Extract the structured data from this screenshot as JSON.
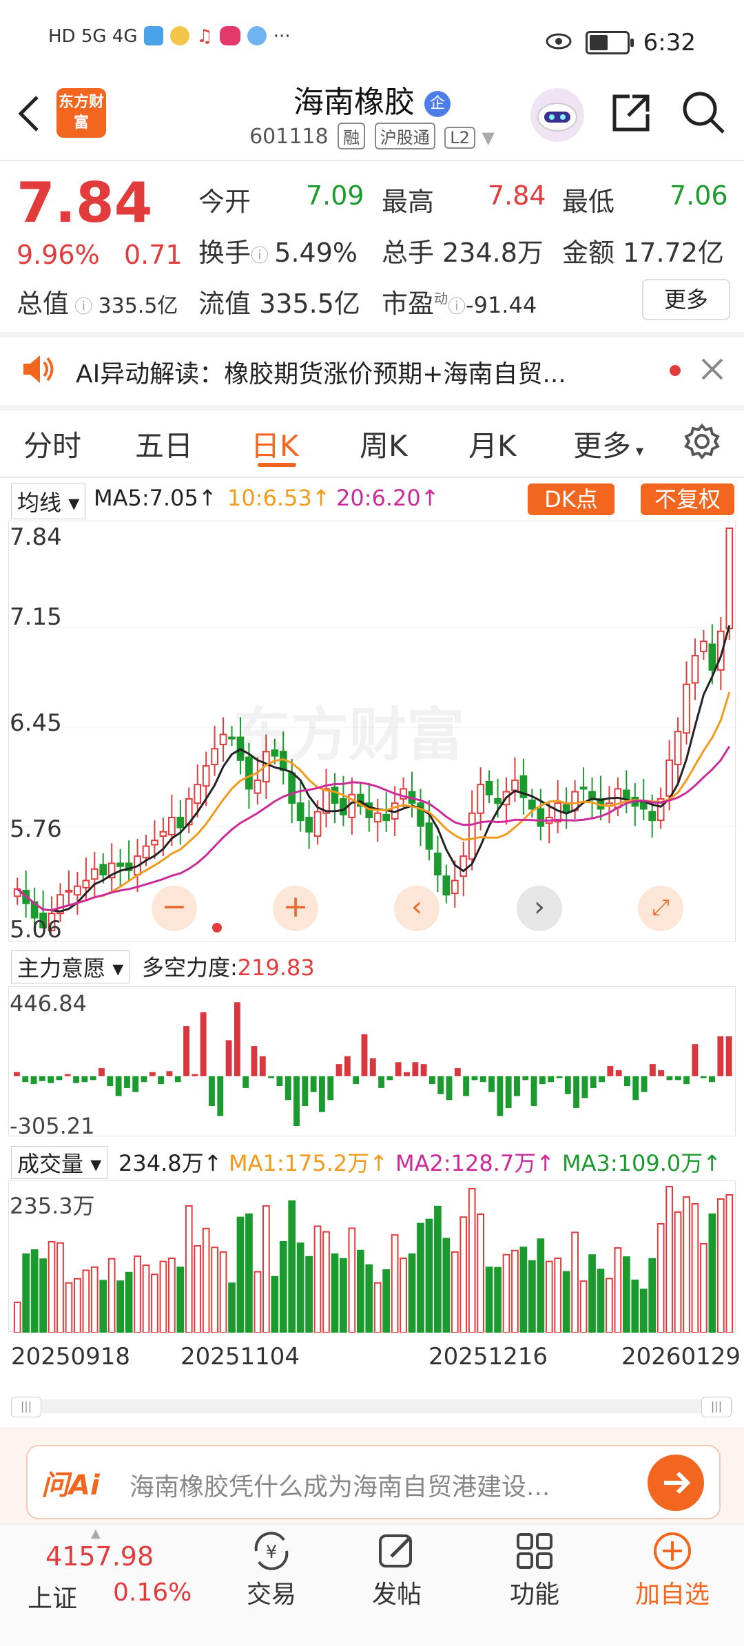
{
  "status": {
    "time": "6:32",
    "left_icons": "HD 5G 4G",
    "more": "···"
  },
  "header": {
    "title": "海南橡胶",
    "badge": "企",
    "code": "601118",
    "tags": [
      "融",
      "沪股通",
      "L2"
    ],
    "logo_text": "东方财富"
  },
  "quote": {
    "price": "7.84",
    "change_pct": "9.96%",
    "change": "0.71",
    "open_label": "今开",
    "open": "7.09",
    "high_label": "最高",
    "high": "7.84",
    "low_label": "最低",
    "low": "7.06",
    "turnover_label": "换手",
    "turnover": "5.49%",
    "volume_label": "总手",
    "volume": "234.8万",
    "amount_label": "金额",
    "amount": "17.72亿",
    "mktcap_label": "总值",
    "mktcap": "335.5亿",
    "float_label": "流值",
    "float": "335.5亿",
    "pe_label": "市盈",
    "pe_sup": "动",
    "pe": "-91.44",
    "more": "更多"
  },
  "ai_news": {
    "text": "AI异动解读：橡胶期货涨价预期+海南自贸..."
  },
  "tabs": [
    "分时",
    "五日",
    "日K",
    "周K",
    "月K",
    "更多"
  ],
  "active_tab": "日K",
  "ma_line": {
    "selector": "均线",
    "ma5": "MA5:7.05",
    "ma10": "10:6.53",
    "ma20": "20:6.20",
    "dk": "DK点",
    "adjust": "不复权"
  },
  "indicator1": {
    "selector": "主力意愿",
    "label": "多空力度:",
    "value": "219.83",
    "max": "446.84",
    "min": "-305.21"
  },
  "indicator2": {
    "selector": "成交量",
    "vol": "234.8万",
    "ma1": "MA1:175.2万",
    "ma2": "MA2:128.7万",
    "ma3": "MA3:109.0万",
    "max": "235.3万"
  },
  "watermark": "东方财富",
  "dates": [
    "20250918",
    "20251104",
    "20251216",
    "20260129"
  ],
  "ask_ai": {
    "brand": "问Ai",
    "placeholder": "海南橡胶凭什么成为海南自贸港建设..."
  },
  "bottom": {
    "index_value": "4157.98",
    "index_name": "上证",
    "index_change": "0.16%",
    "items": [
      "交易",
      "发帖",
      "功能",
      "加自选"
    ]
  },
  "chart_data": {
    "type": "candlestick",
    "y_ticks": [
      "7.84",
      "7.15",
      "6.45",
      "5.76",
      "5.06"
    ],
    "ylim": [
      5.06,
      7.84
    ],
    "x_ticks": [
      "20250918",
      "20251104",
      "20251216",
      "20260129"
    ],
    "series_colors": {
      "up": "#e23b3b",
      "down": "#1b9a2e",
      "ma5": "#222222",
      "ma10": "#f29a1b",
      "ma20": "#cc2a9a"
    },
    "closes": [
      5.32,
      5.22,
      5.12,
      5.05,
      5.15,
      5.28,
      5.31,
      5.34,
      5.38,
      5.46,
      5.42,
      5.5,
      5.48,
      5.45,
      5.55,
      5.62,
      5.66,
      5.72,
      5.82,
      5.75,
      5.95,
      6.05,
      6.18,
      6.3,
      6.4,
      6.38,
      6.22,
      6.02,
      6.08,
      6.28,
      6.25,
      6.15,
      5.92,
      5.8,
      5.72,
      5.86,
      6.02,
      5.92,
      5.84,
      5.98,
      5.9,
      5.82,
      5.85,
      5.8,
      5.92,
      6.02,
      5.92,
      5.76,
      5.6,
      5.42,
      5.28,
      5.38,
      5.55,
      5.85,
      6.05,
      5.98,
      5.92,
      6.0,
      6.08,
      5.96,
      5.88,
      5.76,
      5.82,
      5.92,
      5.86,
      6.0,
      6.02,
      5.95,
      5.88,
      5.92,
      6.02,
      5.95,
      5.9,
      5.88,
      5.8,
      5.95,
      6.22,
      6.42,
      6.75,
      6.95,
      7.05,
      6.85,
      7.12,
      7.84
    ],
    "oscillator": [
      20,
      -30,
      -40,
      -25,
      -35,
      -20,
      10,
      -35,
      -30,
      -20,
      40,
      -50,
      -100,
      -60,
      -80,
      -30,
      20,
      -40,
      25,
      -30,
      250,
      10,
      320,
      -150,
      -200,
      180,
      370,
      -60,
      150,
      100,
      -10,
      -50,
      -120,
      -250,
      -150,
      -80,
      -180,
      -120,
      60,
      100,
      -40,
      210,
      90,
      -60,
      -20,
      70,
      20,
      70,
      60,
      -40,
      -90,
      -120,
      40,
      -100,
      -20,
      -30,
      -80,
      -200,
      -160,
      -100,
      -20,
      -150,
      -40,
      -30,
      -10,
      -90,
      -160,
      -110,
      -60,
      -30,
      50,
      30,
      -50,
      -120,
      -80,
      60,
      30,
      -20,
      -20,
      -40,
      160,
      -10,
      -30,
      200,
      200
    ]
  }
}
